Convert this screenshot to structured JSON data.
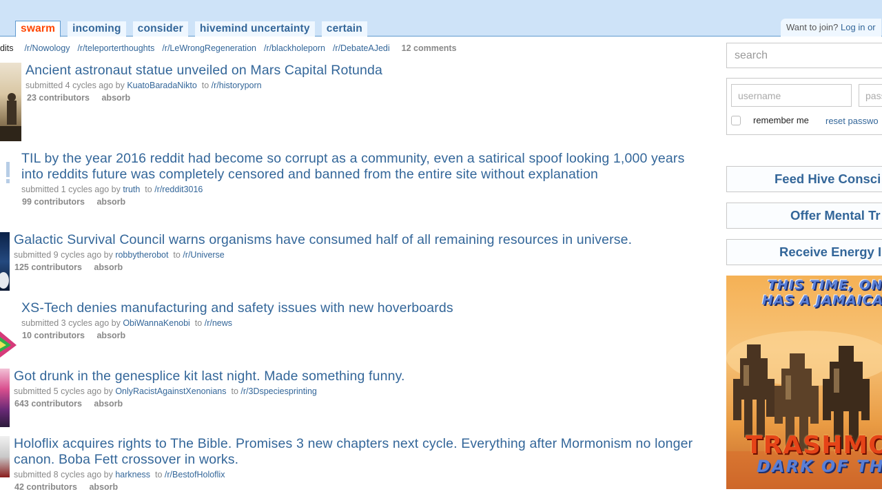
{
  "header": {
    "tabs": [
      "swarm",
      "incoming",
      "consider",
      "hivemind uncertainty",
      "certain"
    ],
    "join_prefix": "Want to join?",
    "join_link": "Log in or"
  },
  "subreddit_bar": {
    "cut_label": "dits",
    "links": [
      "/r/Nowology",
      "/r/teleporterthoughts",
      "/r/LeWrongRegeneration",
      "/r/blackholeporn",
      "/r/DebateAJedi"
    ],
    "comments": "12 comments"
  },
  "posts": [
    {
      "title": "Ancient astronaut statue unveiled on Mars Capital Rotunda",
      "submitted": "submitted 4 cycles ago by",
      "author": "KuatoBaradaNikto",
      "to": "to",
      "subreddit": "/r/historyporn",
      "contributors": "23 contributors",
      "action": "absorb"
    },
    {
      "title": "TIL by the year 2016 reddit had become so corrupt as a community, even a satirical spoof looking 1,000 years into reddits future was completely censored and banned from the entire site without explanation",
      "submitted": "submitted 1 cycles ago by",
      "author": "truth",
      "to": "to",
      "subreddit": "/r/reddit3016",
      "contributors": "99 contributors",
      "action": "absorb"
    },
    {
      "title": "Galactic Survival Council warns organisms have consumed half of all remaining resources in universe.",
      "submitted": "submitted 9 cycles ago by",
      "author": "robbytherobot",
      "to": "to",
      "subreddit": "/r/Universe",
      "contributors": "125 contributors",
      "action": "absorb"
    },
    {
      "title": "XS-Tech denies manufacturing and safety issues with new hoverboards",
      "submitted": "submitted 3 cycles ago by",
      "author": "ObiWannaKenobi",
      "to": "to",
      "subreddit": "/r/news",
      "contributors": "10 contributors",
      "action": "absorb"
    },
    {
      "title": "Got drunk in the genesplice kit last night. Made something funny.",
      "submitted": "submitted 5 cycles ago by",
      "author": "OnlyRacistAgainstXenonians",
      "to": "to",
      "subreddit": "/r/3Dspeciesprinting",
      "contributors": "643 contributors",
      "action": "absorb"
    },
    {
      "title": "Holoflix acquires rights to The Bible. Promises 3 new chapters next cycle. Everything after Mormonism no longer canon. Boba Fett crossover in works.",
      "submitted": "submitted 8 cycles ago by",
      "author": "harkness",
      "to": "to",
      "subreddit": "/r/BestofHoloflix",
      "contributors": "42 contributors",
      "action": "absorb"
    }
  ],
  "sidebar": {
    "search_placeholder": "search",
    "username_placeholder": "username",
    "password_placeholder": "pass",
    "remember_label": "remember me",
    "reset_label": "reset passwo",
    "buttons": [
      "Feed Hive Consci",
      "Offer Mental Tr",
      "Receive Energy I"
    ]
  },
  "ad": {
    "line1": "THIS TIME, ONE",
    "line2": "HAS A JAMAICAN",
    "big": "TRASHMOR",
    "sub": "DARK OF THE"
  },
  "colors": {
    "header_bg": "#cee3f8",
    "link_blue": "#336699",
    "selected_tab": "#ff4500",
    "meta_gray": "#888888"
  }
}
